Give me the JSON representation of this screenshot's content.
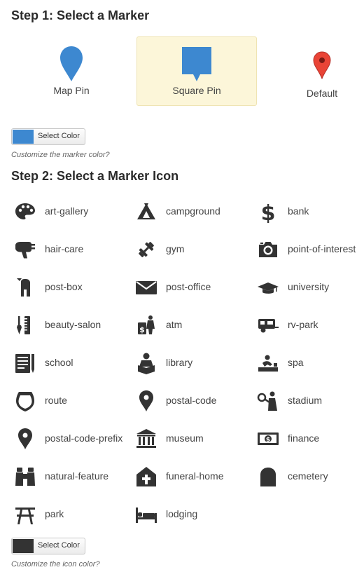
{
  "step1": {
    "title": "Step 1: Select a Marker"
  },
  "markers": [
    {
      "label": "Map Pin",
      "selected": false
    },
    {
      "label": "Square Pin",
      "selected": true
    },
    {
      "label": "Default",
      "selected": false
    }
  ],
  "marker_color": {
    "button_label": "Select Color",
    "swatch": "#3d88d0",
    "hint": "Customize the marker color?"
  },
  "step2": {
    "title": "Step 2: Select a Marker Icon"
  },
  "icons": [
    {
      "label": "art-gallery",
      "icon": "art-gallery-icon"
    },
    {
      "label": "campground",
      "icon": "campground-icon"
    },
    {
      "label": "bank",
      "icon": "bank-icon"
    },
    {
      "label": "hair-care",
      "icon": "hair-care-icon"
    },
    {
      "label": "gym",
      "icon": "gym-icon"
    },
    {
      "label": "point-of-interest",
      "icon": "point-of-interest-icon"
    },
    {
      "label": "post-box",
      "icon": "post-box-icon"
    },
    {
      "label": "post-office",
      "icon": "post-office-icon"
    },
    {
      "label": "university",
      "icon": "university-icon"
    },
    {
      "label": "beauty-salon",
      "icon": "beauty-salon-icon"
    },
    {
      "label": "atm",
      "icon": "atm-icon"
    },
    {
      "label": "rv-park",
      "icon": "rv-park-icon"
    },
    {
      "label": "school",
      "icon": "school-icon"
    },
    {
      "label": "library",
      "icon": "library-icon"
    },
    {
      "label": "spa",
      "icon": "spa-icon"
    },
    {
      "label": "route",
      "icon": "route-icon"
    },
    {
      "label": "postal-code",
      "icon": "postal-code-icon"
    },
    {
      "label": "stadium",
      "icon": "stadium-icon"
    },
    {
      "label": "postal-code-prefix",
      "icon": "postal-code-prefix-icon"
    },
    {
      "label": "museum",
      "icon": "museum-icon"
    },
    {
      "label": "finance",
      "icon": "finance-icon"
    },
    {
      "label": "natural-feature",
      "icon": "natural-feature-icon"
    },
    {
      "label": "funeral-home",
      "icon": "funeral-home-icon"
    },
    {
      "label": "cemetery",
      "icon": "cemetery-icon"
    },
    {
      "label": "park",
      "icon": "park-icon"
    },
    {
      "label": "lodging",
      "icon": "lodging-icon"
    }
  ],
  "icon_color": {
    "button_label": "Select Color",
    "swatch": "#333333",
    "hint": "Customize the icon color?"
  },
  "colors": {
    "icon": "#333333",
    "default_pin": "#e94436",
    "selected_bg": "#fcf6d9"
  }
}
